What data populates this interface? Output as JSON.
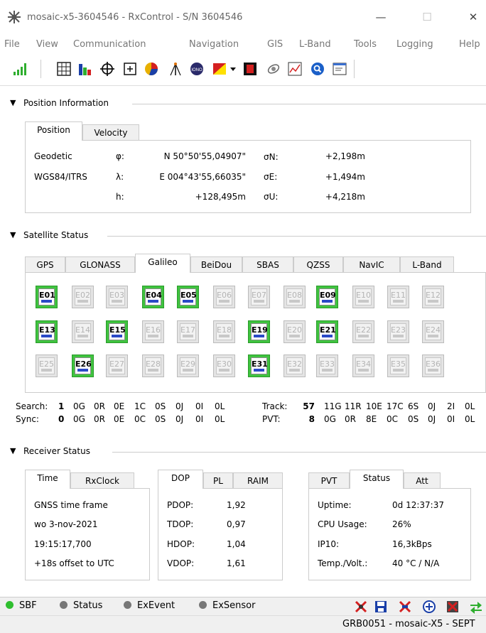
{
  "window": {
    "title": "mosaic-x5-3604546 - RxControl - S/N 3604546"
  },
  "menu": [
    "File",
    "View",
    "Communication",
    "Navigation",
    "GIS",
    "L-Band",
    "Tools",
    "Logging",
    "Help"
  ],
  "sections": {
    "position": "Position Information",
    "satellite": "Satellite Status",
    "receiver": "Receiver Status"
  },
  "position": {
    "tabs": [
      "Position",
      "Velocity"
    ],
    "frame1": "Geodetic",
    "frame2": "WGS84/ITRS",
    "sym_lat": "φ:",
    "sym_lon": "λ:",
    "sym_h": "h:",
    "lat": "N 50°50'55,04907\"",
    "lon": "E 004°43'55,66035\"",
    "height": "+128,495m",
    "sig_n": "σN:",
    "sig_e": "σE:",
    "sig_u": "σU:",
    "sig_n_val": "+2,198m",
    "sig_e_val": "+1,494m",
    "sig_u_val": "+4,218m"
  },
  "satellite": {
    "tabs": [
      "GPS",
      "GLONASS",
      "Galileo",
      "BeiDou",
      "SBAS",
      "QZSS",
      "NavIC",
      "L-Band"
    ],
    "active_tab": "Galileo",
    "rows": [
      [
        {
          "id": "E01",
          "on": true
        },
        {
          "id": "E02",
          "on": false
        },
        {
          "id": "E03",
          "on": false
        },
        {
          "id": "E04",
          "on": true
        },
        {
          "id": "E05",
          "on": true
        },
        {
          "id": "E06",
          "on": false
        },
        {
          "id": "E07",
          "on": false
        },
        {
          "id": "E08",
          "on": false
        },
        {
          "id": "E09",
          "on": true
        },
        {
          "id": "E10",
          "on": false
        },
        {
          "id": "E11",
          "on": false
        },
        {
          "id": "E12",
          "on": false
        }
      ],
      [
        {
          "id": "E13",
          "on": true
        },
        {
          "id": "E14",
          "on": false
        },
        {
          "id": "E15",
          "on": true
        },
        {
          "id": "E16",
          "on": false
        },
        {
          "id": "E17",
          "on": false
        },
        {
          "id": "E18",
          "on": false
        },
        {
          "id": "E19",
          "on": true
        },
        {
          "id": "E20",
          "on": false
        },
        {
          "id": "E21",
          "on": true
        },
        {
          "id": "E22",
          "on": false
        },
        {
          "id": "E23",
          "on": false
        },
        {
          "id": "E24",
          "on": false
        }
      ],
      [
        {
          "id": "E25",
          "on": false
        },
        {
          "id": "E26",
          "on": true
        },
        {
          "id": "E27",
          "on": false
        },
        {
          "id": "E28",
          "on": false
        },
        {
          "id": "E29",
          "on": false
        },
        {
          "id": "E30",
          "on": false
        },
        {
          "id": "E31",
          "on": true
        },
        {
          "id": "E32",
          "on": false
        },
        {
          "id": "E33",
          "on": false
        },
        {
          "id": "E34",
          "on": false
        },
        {
          "id": "E35",
          "on": false
        },
        {
          "id": "E36",
          "on": false
        }
      ]
    ],
    "search_label": "Search:",
    "search_count": "1",
    "search_vals": [
      "0G",
      "0R",
      "0E",
      "1C",
      "0S",
      "0J",
      "0I",
      "0L"
    ],
    "sync_label": "Sync:",
    "sync_count": "0",
    "sync_vals": [
      "0G",
      "0R",
      "0E",
      "0C",
      "0S",
      "0J",
      "0I",
      "0L"
    ],
    "track_label": "Track:",
    "track_count": "57",
    "track_vals": [
      "11G",
      "11R",
      "10E",
      "17C",
      "6S",
      "0J",
      "2I",
      "0L"
    ],
    "pvt_label": "PVT:",
    "pvt_count": "8",
    "pvt_vals": [
      "0G",
      "0R",
      "8E",
      "0C",
      "0S",
      "0J",
      "0I",
      "0L"
    ]
  },
  "receiver": {
    "time_tabs": [
      "Time",
      "RxClock"
    ],
    "time_lines": [
      "GNSS time frame",
      "wo 3-nov-2021",
      "19:15:17,700",
      "+18s offset to UTC"
    ],
    "dop_tabs": [
      "DOP",
      "PL",
      "RAIM"
    ],
    "dop": [
      {
        "k": "PDOP:",
        "v": "1,92"
      },
      {
        "k": "TDOP:",
        "v": "0,97"
      },
      {
        "k": "HDOP:",
        "v": "1,04"
      },
      {
        "k": "VDOP:",
        "v": "1,61"
      }
    ],
    "status_tabs": [
      "PVT",
      "Status",
      "Att"
    ],
    "status": [
      {
        "k": "Uptime:",
        "v": "0d 12:37:37"
      },
      {
        "k": "CPU Usage:",
        "v": "26%"
      },
      {
        "k": "IP10:",
        "v": "16,3kBps"
      },
      {
        "k": "Temp./Volt.:",
        "v": "40 °C / N/A"
      }
    ]
  },
  "statusbar": {
    "items": [
      "SBF",
      "Status",
      "ExEvent",
      "ExSensor"
    ],
    "bottom": "GRB0051 - mosaic-X5 - SEPT"
  },
  "colors": {
    "sat_on": "#3fc33f",
    "sat_signal": "#2b49c7",
    "sbf_dot": "#2fbf2f"
  },
  "toolbar_icons": [
    "signal-bars-icon",
    "grid-icon",
    "bar-chart-icon",
    "crosshair-icon",
    "add-box-icon",
    "pie-chart-icon",
    "antenna-icon",
    "iono-icon",
    "color-flag-icon",
    "dropdown-arrow-icon",
    "record-icon",
    "satellite-icon",
    "plot-icon",
    "search-icon",
    "terminal-icon"
  ]
}
